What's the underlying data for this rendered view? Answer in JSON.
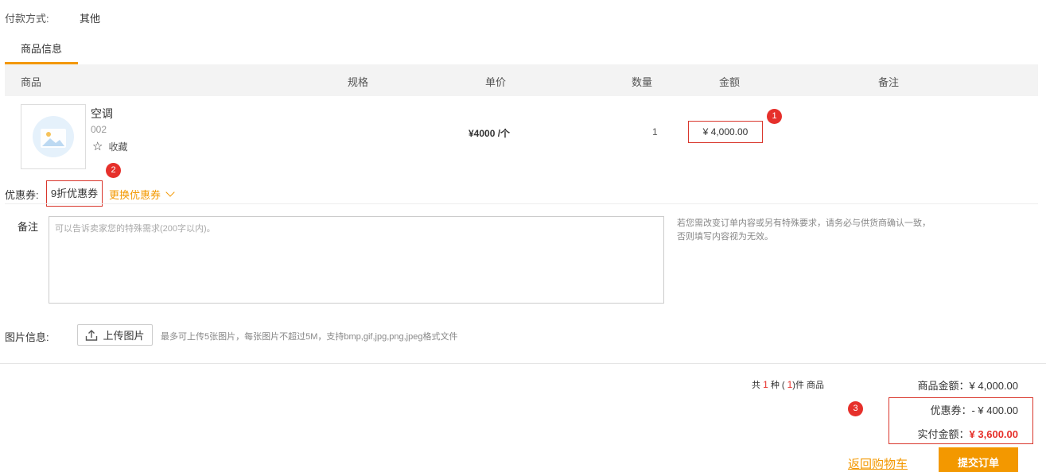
{
  "payment": {
    "label": "付款方式:",
    "value": "其他"
  },
  "tab": {
    "label": "商品信息"
  },
  "table": {
    "headers": {
      "product": "商品",
      "spec": "规格",
      "unit_price": "单价",
      "quantity": "数量",
      "amount": "金额",
      "remark": "备注"
    }
  },
  "item": {
    "name": "空调",
    "code": "002",
    "favorite_label": "收藏",
    "unit_price": "¥4000 /个",
    "quantity": "1",
    "amount": "¥ 4,000.00"
  },
  "annotations": [
    "1",
    "2",
    "3"
  ],
  "coupon": {
    "label": "优惠券:",
    "value": "9折优惠券",
    "change_label": "更换优惠券"
  },
  "remark": {
    "label": "备注",
    "placeholder": "可以告诉卖家您的特殊需求(200字以内)。",
    "note": "若您需改变订单内容或另有特殊要求，请务必与供货商确认一致，否则填写内容视为无效。"
  },
  "images": {
    "label": "图片信息:",
    "upload_label": "上传图片",
    "hint": "最多可上传5张图片，每张图片不超过5M，支持bmp,gif,jpg,png,jpeg格式文件"
  },
  "summary": {
    "count_prefix": "共",
    "kinds": "1",
    "kinds_unit": "种 (",
    "pieces": "1",
    "pieces_unit": ")件 商品",
    "goods_label": "商品金额：",
    "goods_value": "¥ 4,000.00",
    "coupon_label": "优惠券：",
    "coupon_value": "- ¥ 400.00",
    "pay_label": "实付金额：",
    "pay_value": "¥ 3,600.00"
  },
  "actions": {
    "back_label": "返回购物车",
    "submit_label": "提交订单"
  },
  "colors": {
    "accent": "#f39800",
    "highlight": "#d9362c",
    "badge": "#e6302b"
  }
}
